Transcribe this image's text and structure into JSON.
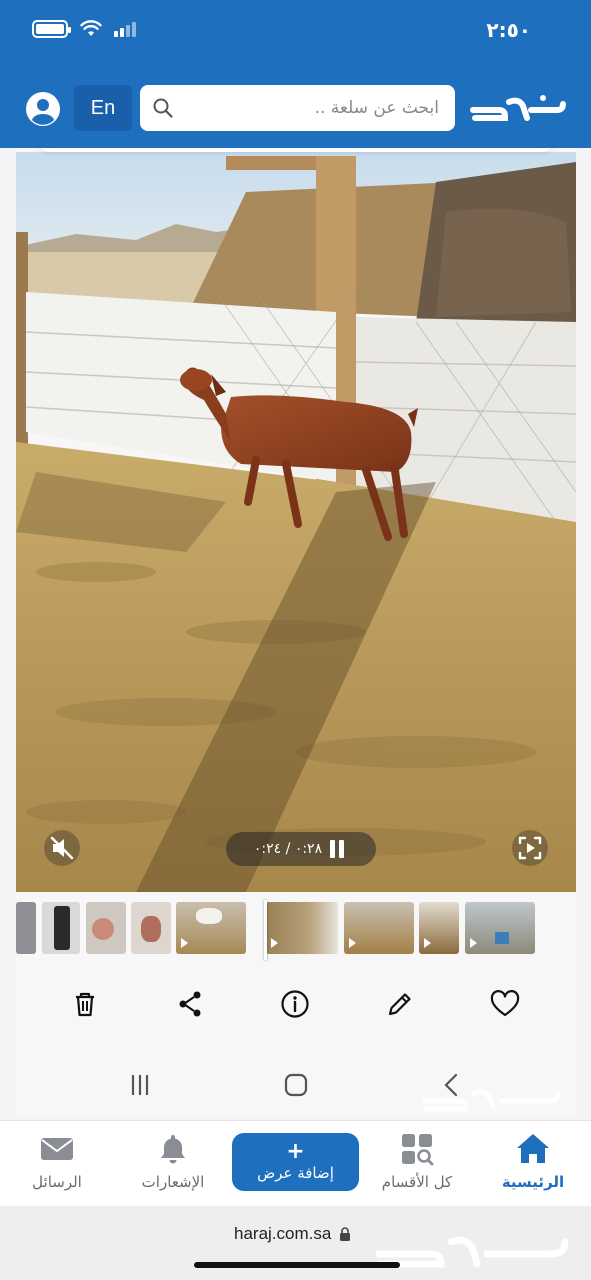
{
  "status_bar": {
    "time": "٢:٥٠",
    "icons": [
      "battery-icon",
      "wifi-icon",
      "cellular-signal-icon"
    ]
  },
  "header": {
    "language_button": "En",
    "search_placeholder": "ابحث عن سلعة ..",
    "brand": "حراج",
    "accent_color": "#1f6fbf"
  },
  "media": {
    "time_display": "٠:٢٨ / ٠:٢٤",
    "playing": true,
    "thumbnail_count": 12
  },
  "actions": [
    "delete",
    "share",
    "info",
    "edit",
    "favorite"
  ],
  "tab_bar": {
    "tabs": [
      {
        "label": "الرسائل",
        "icon": "mail-icon"
      },
      {
        "label": "الإشعارات",
        "icon": "bell-icon"
      },
      {
        "label": "كل الأقسام",
        "icon": "categories-icon"
      },
      {
        "label": "الرئيسية",
        "icon": "home-icon"
      }
    ],
    "add_button": {
      "plus": "+",
      "label": "إضافة عرض"
    },
    "active": "الرئيسية"
  },
  "browser": {
    "url": "haraj.com.sa"
  }
}
